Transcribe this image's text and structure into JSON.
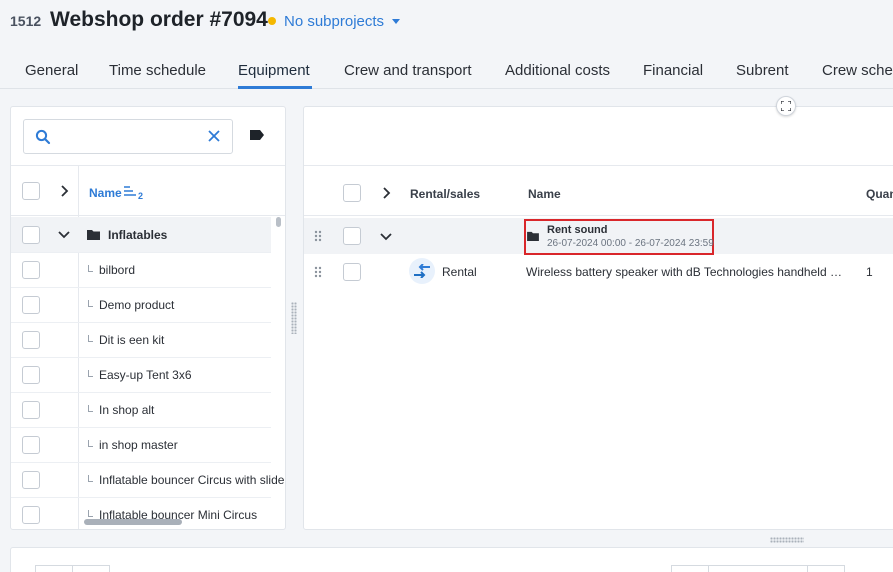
{
  "header": {
    "project_id": "1512",
    "title": "Webshop order #7094",
    "status_color": "#f5b800",
    "subprojects_label": "No subprojects"
  },
  "tabs": [
    {
      "label": "General"
    },
    {
      "label": "Time schedule"
    },
    {
      "label": "Equipment",
      "active": true
    },
    {
      "label": "Crew and transport"
    },
    {
      "label": "Additional costs"
    },
    {
      "label": "Financial"
    },
    {
      "label": "Subrent"
    },
    {
      "label": "Crew schedule"
    }
  ],
  "left_panel": {
    "search_value": "",
    "name_header": "Name",
    "sort_order": "2",
    "group": {
      "label": "Inflatables"
    },
    "items": [
      {
        "label": "bilbord"
      },
      {
        "label": "Demo product"
      },
      {
        "label": "Dit is een kit"
      },
      {
        "label": "Easy-up Tent 3x6"
      },
      {
        "label": "In shop alt"
      },
      {
        "label": "in shop master"
      },
      {
        "label": "Inflatable bouncer Circus with slide"
      },
      {
        "label": "Inflatable bouncer Mini Circus"
      }
    ]
  },
  "right_panel": {
    "columns": {
      "rental_sales": "Rental/sales",
      "name": "Name",
      "quantity": "Quantity"
    },
    "group": {
      "title": "Rent sound",
      "dates": "26-07-2024 00:00 - 26-07-2024 23:59"
    },
    "rows": [
      {
        "type": "Rental",
        "name": "Wireless battery speaker with dB Technologies handheld microphone",
        "quantity": "1"
      }
    ]
  },
  "colors": {
    "accent": "#2e7bd6",
    "highlight_box": "#d9262a"
  }
}
